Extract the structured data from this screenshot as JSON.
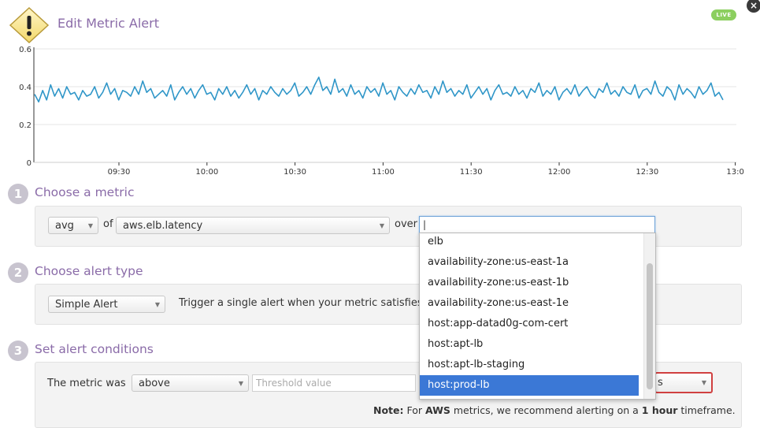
{
  "header": {
    "title": "Edit Metric Alert",
    "live_badge": "LIVE",
    "close_label": "×"
  },
  "chart_data": {
    "type": "line",
    "x_tick_labels": [
      "09:30",
      "10:00",
      "10:30",
      "11:00",
      "11:30",
      "12:00",
      "12:30",
      "13:0"
    ],
    "y_tick_labels": [
      "0.6",
      "0.4",
      "0.2",
      "0"
    ],
    "ylim": [
      0,
      0.6
    ],
    "grid": true,
    "series_color": "#2f96c8",
    "series": [
      {
        "values": [
          0.36,
          0.32,
          0.38,
          0.33,
          0.41,
          0.35,
          0.39,
          0.34,
          0.4,
          0.36,
          0.37,
          0.33,
          0.38,
          0.35,
          0.36,
          0.4,
          0.34,
          0.37,
          0.42,
          0.36,
          0.39,
          0.33,
          0.38,
          0.37,
          0.35,
          0.4,
          0.36,
          0.43,
          0.37,
          0.39,
          0.34,
          0.36,
          0.38,
          0.35,
          0.41,
          0.33,
          0.37,
          0.4,
          0.36,
          0.39,
          0.34,
          0.38,
          0.41,
          0.36,
          0.37,
          0.33,
          0.39,
          0.36,
          0.4,
          0.35,
          0.38,
          0.34,
          0.37,
          0.41,
          0.36,
          0.39,
          0.33,
          0.38,
          0.36,
          0.4,
          0.37,
          0.35,
          0.39,
          0.36,
          0.38,
          0.42,
          0.35,
          0.37,
          0.4,
          0.36,
          0.41,
          0.45,
          0.38,
          0.4,
          0.36,
          0.44,
          0.37,
          0.39,
          0.35,
          0.41,
          0.36,
          0.38,
          0.34,
          0.4,
          0.37,
          0.39,
          0.35,
          0.42,
          0.36,
          0.38,
          0.33,
          0.4,
          0.37,
          0.35,
          0.39,
          0.36,
          0.41,
          0.37,
          0.38,
          0.34,
          0.4,
          0.36,
          0.43,
          0.37,
          0.39,
          0.35,
          0.38,
          0.36,
          0.41,
          0.34,
          0.37,
          0.4,
          0.36,
          0.39,
          0.33,
          0.38,
          0.41,
          0.36,
          0.37,
          0.35,
          0.4,
          0.36,
          0.38,
          0.34,
          0.39,
          0.37,
          0.42,
          0.35,
          0.38,
          0.36,
          0.4,
          0.33,
          0.37,
          0.39,
          0.36,
          0.41,
          0.35,
          0.38,
          0.4,
          0.36,
          0.34,
          0.39,
          0.37,
          0.42,
          0.36,
          0.38,
          0.35,
          0.4,
          0.37,
          0.36,
          0.41,
          0.34,
          0.38,
          0.39,
          0.36,
          0.43,
          0.37,
          0.35,
          0.4,
          0.38,
          0.33,
          0.41,
          0.36,
          0.39,
          0.37,
          0.34,
          0.4,
          0.36,
          0.38,
          0.42,
          0.35,
          0.37,
          0.33
        ]
      }
    ]
  },
  "step1": {
    "number": "1",
    "title": "Choose a metric",
    "aggregator": "avg",
    "of_label": "of",
    "metric": "aws.elb.latency",
    "over_label": "over",
    "over_value": ""
  },
  "step2": {
    "number": "2",
    "title": "Choose alert type",
    "alert_type": "Simple Alert",
    "description": "Trigger a single alert when your metric satisfies"
  },
  "step3": {
    "number": "3",
    "title": "Set alert conditions",
    "metric_was_label": "The metric was",
    "comparator": "above",
    "threshold_placeholder": "Threshold value",
    "timeframe_fragment": "s",
    "note_prefix": "Note:",
    "note_text1": " For ",
    "note_aws": "AWS",
    "note_text2": " metrics, we recommend alerting on a ",
    "note_hour": "1 hour",
    "note_text3": " timeframe."
  },
  "dropdown": {
    "items": [
      "elb",
      "availability-zone:us-east-1a",
      "availability-zone:us-east-1b",
      "availability-zone:us-east-1e",
      "host:app-datad0g-com-cert",
      "host:apt-lb",
      "host:apt-lb-staging",
      "host:prod-lb"
    ],
    "selected_index": 7
  }
}
